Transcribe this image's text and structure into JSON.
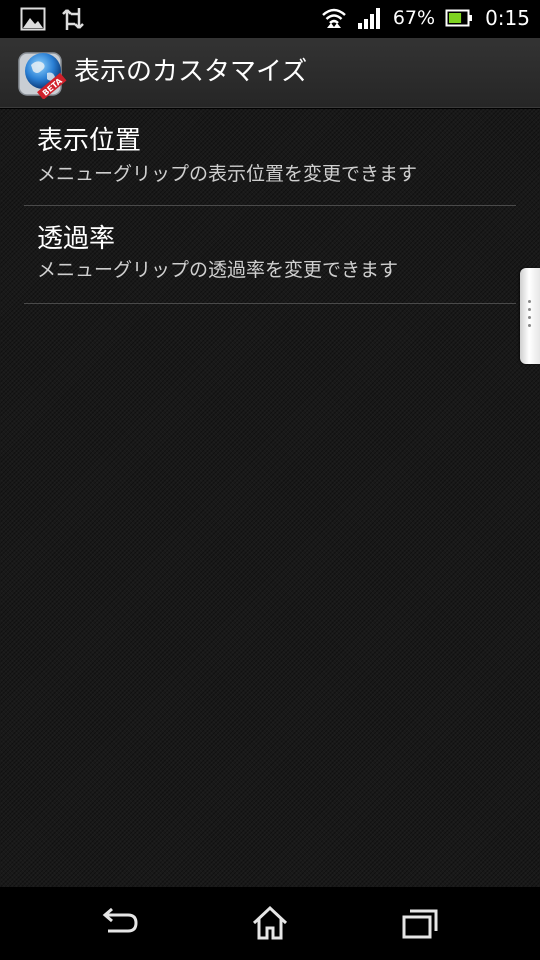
{
  "status_bar": {
    "battery_percent": "67%",
    "time": "0:15",
    "icons": [
      "gallery-icon",
      "data-sync-icon",
      "wifi-icon",
      "signal-icon",
      "battery-icon"
    ],
    "battery_level": 0.67
  },
  "action_bar": {
    "title": "表示のカスタマイズ",
    "app_icon": "globe-beta-icon",
    "badge": "BETA"
  },
  "preferences": [
    {
      "title": "表示位置",
      "summary": "メニューグリップの表示位置を変更できます"
    },
    {
      "title": "透過率",
      "summary": "メニューグリップの透過率を変更できます"
    }
  ],
  "nav_bar": {
    "icons": [
      "back-icon",
      "home-icon",
      "recent-apps-icon"
    ]
  },
  "colors": {
    "background": "#191919",
    "text": "#ffffff",
    "summary_text": "#cfcfcf",
    "divider": "#4a4a4a",
    "battery_fill": "#7ed321"
  }
}
